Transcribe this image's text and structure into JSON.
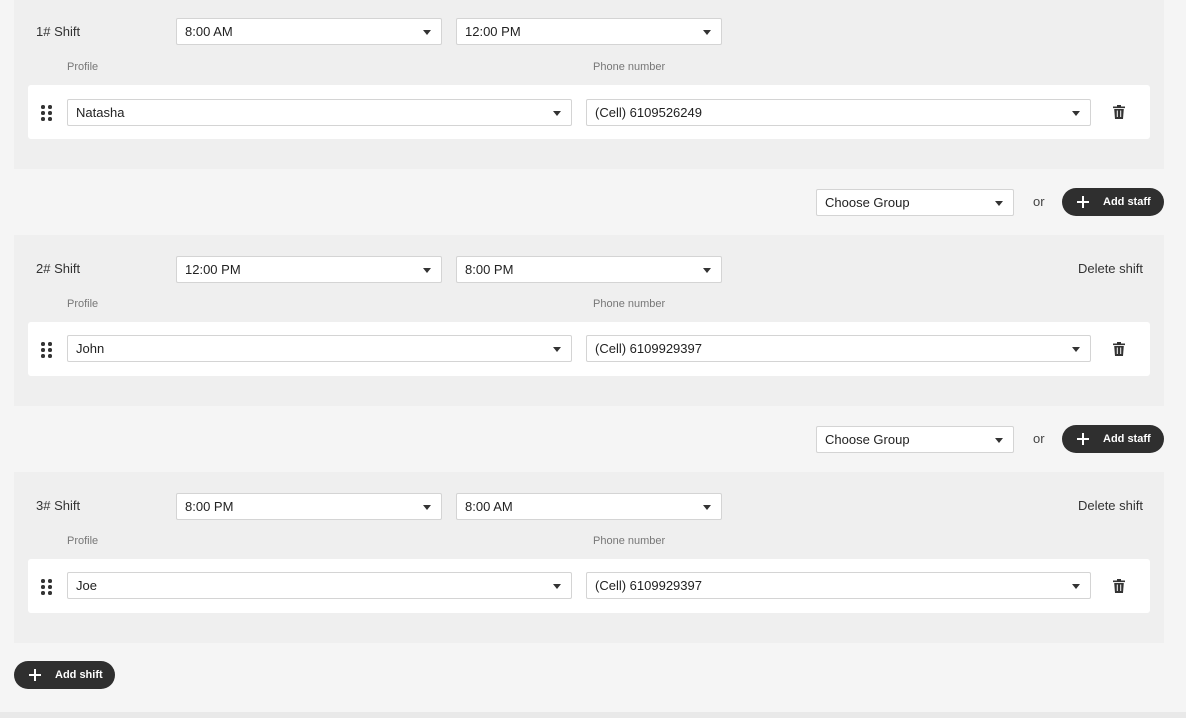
{
  "shifts": [
    {
      "title": "1# Shift",
      "start_time": "8:00 AM",
      "end_time": "12:00 PM",
      "delete_label": "",
      "profile_label": "Profile",
      "phone_label": "Phone number",
      "staff": [
        {
          "profile": "Natasha",
          "phone": "(Cell) 6109526249"
        }
      ]
    },
    {
      "title": "2# Shift",
      "start_time": "12:00 PM",
      "end_time": "8:00 PM",
      "delete_label": "Delete shift",
      "profile_label": "Profile",
      "phone_label": "Phone number",
      "staff": [
        {
          "profile": "John",
          "phone": "(Cell) 6109929397"
        }
      ]
    },
    {
      "title": "3# Shift",
      "start_time": "8:00 PM",
      "end_time": "8:00 AM",
      "delete_label": "Delete shift",
      "profile_label": "Profile",
      "phone_label": "Phone number",
      "staff": [
        {
          "profile": "Joe",
          "phone": "(Cell) 6109929397"
        }
      ]
    }
  ],
  "group_actions": [
    {
      "group_select": "Choose Group",
      "or_text": "or",
      "add_staff_label": "Add staff"
    },
    {
      "group_select": "Choose Group",
      "or_text": "or",
      "add_staff_label": "Add staff"
    }
  ],
  "add_shift_label": "Add shift",
  "icons": {
    "drag": "drag-handle-icon",
    "trash": "trash-icon",
    "plus": "plus-icon",
    "caret": "caret-down-icon"
  },
  "colors": {
    "button_bg": "#2f2f2f",
    "card_bg": "#efefef",
    "page_bg": "#f5f5f5"
  }
}
